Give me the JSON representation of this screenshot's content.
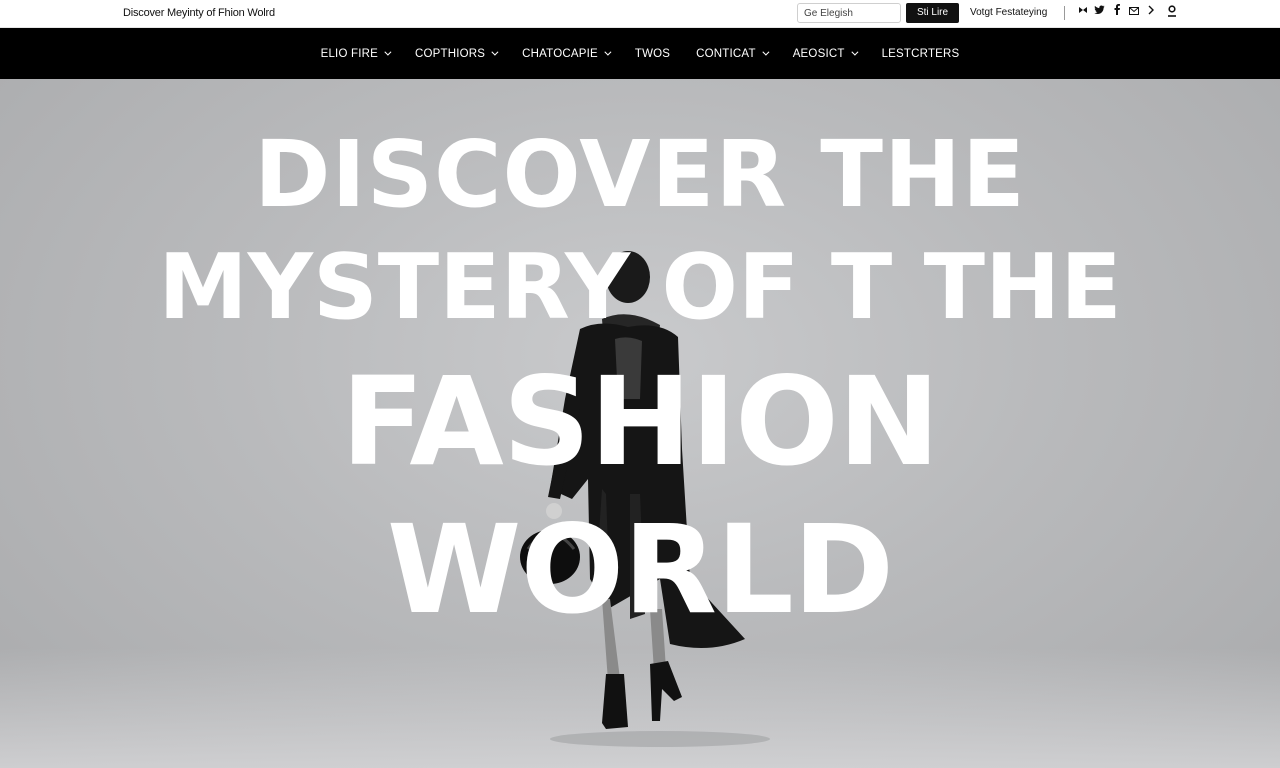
{
  "header": {
    "site_title": "Discover Meyinty of Fhion Wolrd",
    "search_placeholder": "Ge Elegish",
    "signup_label": "Sti Lire",
    "tagline": "Votgt Festateying",
    "social_icons": [
      "bird-icon",
      "twitter-icon",
      "facebook-icon",
      "mail-icon",
      "chevron-right-icon"
    ],
    "account_icon": "user-icon"
  },
  "nav": {
    "items": [
      {
        "label": "ELIO FIRE",
        "dropdown": true
      },
      {
        "label": "COPTHIORS",
        "dropdown": true
      },
      {
        "label": "CHATOCAPIE",
        "dropdown": true
      },
      {
        "label": "TWOS",
        "dropdown": false
      },
      {
        "label": "CONTICAT",
        "dropdown": true
      },
      {
        "label": "AEOSICT",
        "dropdown": true
      },
      {
        "label": "LESTCRTERS",
        "dropdown": false
      }
    ]
  },
  "hero": {
    "line1": "DISCOVER THE",
    "line2": "MYSTERY OF T THE",
    "line3": "FASHION",
    "line4": "WORLD"
  },
  "colors": {
    "nav_bg": "#000000",
    "hero_bg": "#b9babc",
    "hero_text": "#ffffff"
  }
}
